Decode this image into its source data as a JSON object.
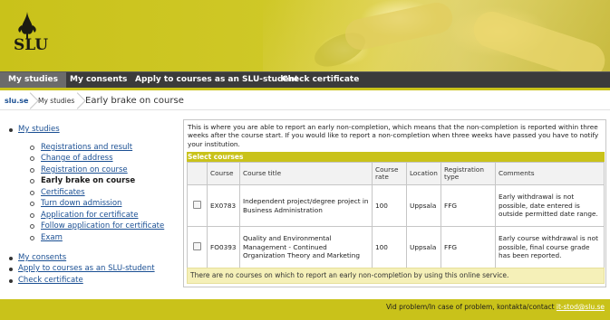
{
  "brand": {
    "logo_text": "SLU"
  },
  "nav": {
    "items": [
      {
        "label": "My studies",
        "active": true
      },
      {
        "label": "My consents",
        "active": false
      },
      {
        "label": "Apply to courses as an SLU-student",
        "active": false
      },
      {
        "label": "Check certificate",
        "active": false
      }
    ]
  },
  "breadcrumb": {
    "home": "slu.se",
    "parent": "My studies",
    "current": "Early brake on course"
  },
  "sidebar": {
    "top": "My studies",
    "sub": [
      "Registrations and result",
      "Change of address",
      "Registration on course",
      "Early brake on course",
      "Certificates",
      "Turn down admission",
      "Application for certificate",
      "Follow application for certificate",
      "Exam"
    ],
    "current_index": 3,
    "bottom": [
      "My consents",
      "Apply to courses as an SLU-student",
      "Check certificate"
    ]
  },
  "main": {
    "intro": "This is where you are able to report an early non-completion, which means that the non-completion is reported within three weeks after the course start. If you would like to report a non-completion when three weeks have passed you have to notify your institution.",
    "select_label": "Select courses",
    "columns": [
      "Course",
      "Course title",
      "Course rate",
      "Location",
      "Registration type",
      "Comments"
    ],
    "rows": [
      {
        "course": "EX0783",
        "title": "Independent project/degree project in Business Administration",
        "rate": "100",
        "location": "Uppsala",
        "reg_type": "FFG",
        "comment": "Early withdrawal is not possible, date entered is outside permitted date range.",
        "checked": false
      },
      {
        "course": "FO0393",
        "title": "Quality and Environmental Management - Continued Organization Theory and Marketing",
        "rate": "100",
        "location": "Uppsala",
        "reg_type": "FFG",
        "comment": "Early course withdrawal is not possible, final course grade has been reported.",
        "checked": false
      }
    ],
    "notice": "There are no courses on which to report an early non-completion by using this online service."
  },
  "footer": {
    "text": "Vid problem/In case of problem, kontakta/contact",
    "email": "it-stod@slu.se"
  },
  "colors": {
    "accent": "#c9c21a",
    "nav_bg": "#3b3b3b",
    "link": "#1a4f93",
    "notice_bg": "#f5f0b8"
  }
}
